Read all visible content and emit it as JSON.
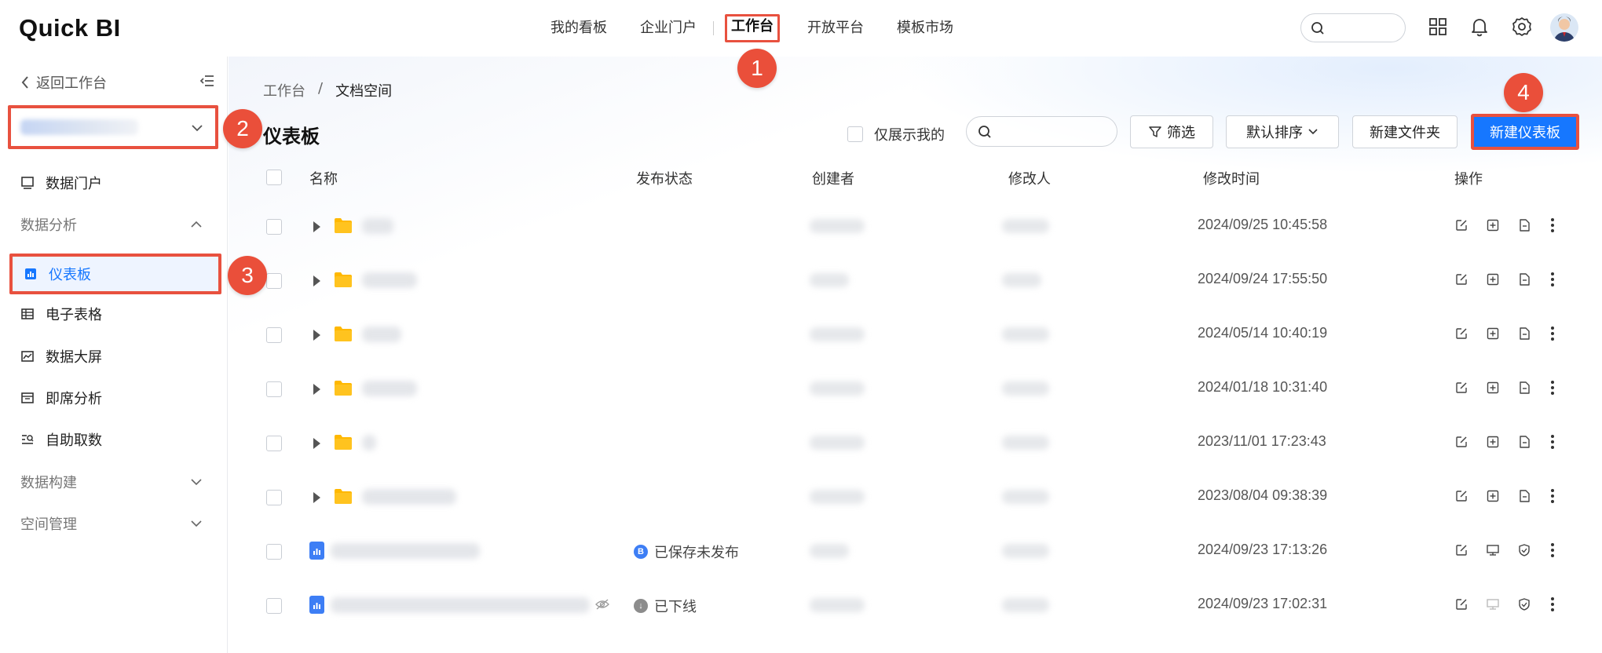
{
  "app": {
    "logo": "Quick BI"
  },
  "topnav": {
    "items": [
      "我的看板",
      "企业门户",
      "工作台",
      "开放平台",
      "模板市场"
    ],
    "active": "工作台"
  },
  "badges": [
    "1",
    "2",
    "3",
    "4"
  ],
  "sidebar": {
    "back_label": "返回工作台",
    "items": {
      "data_portal": "数据门户",
      "group_analysis": "数据分析",
      "dashboard": "仪表板",
      "spreadsheet": "电子表格",
      "big_screen": "数据大屏",
      "adhoc": "即席分析",
      "self_service": "自助取数",
      "group_build": "数据构建",
      "group_space": "空间管理"
    }
  },
  "main": {
    "breadcrumb": [
      "工作台",
      "/",
      "文档空间"
    ],
    "title": "仪表板",
    "only_mine_label": "仅展示我的",
    "filter_label": "筛选",
    "sort_label": "默认排序",
    "new_folder_label": "新建文件夹",
    "new_dashboard_label": "新建仪表板"
  },
  "table": {
    "headers": [
      "名称",
      "发布状态",
      "创建者",
      "修改人",
      "修改时间",
      "操作"
    ],
    "rows": [
      {
        "type": "folder",
        "status": "",
        "mtime": "2024/09/25 10:45:58"
      },
      {
        "type": "folder",
        "status": "",
        "mtime": "2024/09/24 17:55:50"
      },
      {
        "type": "folder",
        "status": "",
        "mtime": "2024/05/14 10:40:19"
      },
      {
        "type": "folder",
        "status": "",
        "mtime": "2024/01/18 10:31:40"
      },
      {
        "type": "folder",
        "status": "",
        "mtime": "2023/11/01 17:23:43"
      },
      {
        "type": "folder",
        "status": "",
        "mtime": "2023/08/04 09:38:39"
      },
      {
        "type": "dashboard",
        "status": "已保存未发布",
        "status_icon": "B",
        "mtime": "2024/09/23 17:13:26"
      },
      {
        "type": "dashboard",
        "status": "已下线",
        "status_icon": "↓",
        "mtime": "2024/09/23 17:02:31"
      }
    ]
  },
  "colors": {
    "accent": "#1677ff",
    "highlight": "#e8513f",
    "folder": "#ffb800"
  }
}
